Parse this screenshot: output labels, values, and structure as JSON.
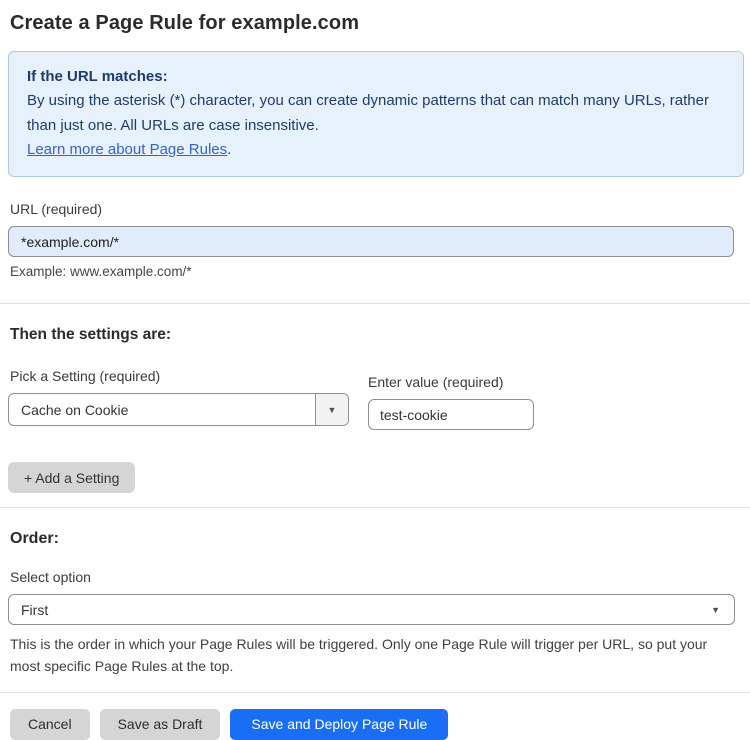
{
  "page": {
    "title": "Create a Page Rule for example.com"
  },
  "info_box": {
    "heading": "If the URL matches:",
    "body": "By using the asterisk (*) character, you can create dynamic patterns that can match many URLs, rather than just one. All URLs are case insensitive.",
    "link_label": "Learn more about Page Rules",
    "link_suffix": "."
  },
  "url_field": {
    "label": "URL (required)",
    "value": "*example.com/*",
    "helper": "Example: www.example.com/*"
  },
  "settings": {
    "heading": "Then the settings are:",
    "setting_label": "Pick a Setting (required)",
    "setting_selected": "Cache on Cookie",
    "value_label": "Enter value (required)",
    "value_text": "test-cookie",
    "add_button_label": "+ Add a Setting"
  },
  "order": {
    "heading": "Order:",
    "label": "Select option",
    "selected": "First",
    "helper": "This is the order in which your Page Rules will be triggered. Only one Page Rule will trigger per URL, so put your most specific Page Rules at the top."
  },
  "actions": {
    "cancel_label": "Cancel",
    "save_draft_label": "Save as Draft",
    "save_deploy_label": "Save and Deploy Page Rule"
  },
  "icons": {
    "dropdown_caret": "▼"
  },
  "colors": {
    "primary_button_blue": "#1a6ef5",
    "info_box_background": "#e7f1fb",
    "info_box_border": "#a9cbe8",
    "info_box_text": "#1d3c6e",
    "link_blue": "#3565c2",
    "url_input_background": "#e0ebfb",
    "gray_button_background": "#d5d5d5"
  }
}
